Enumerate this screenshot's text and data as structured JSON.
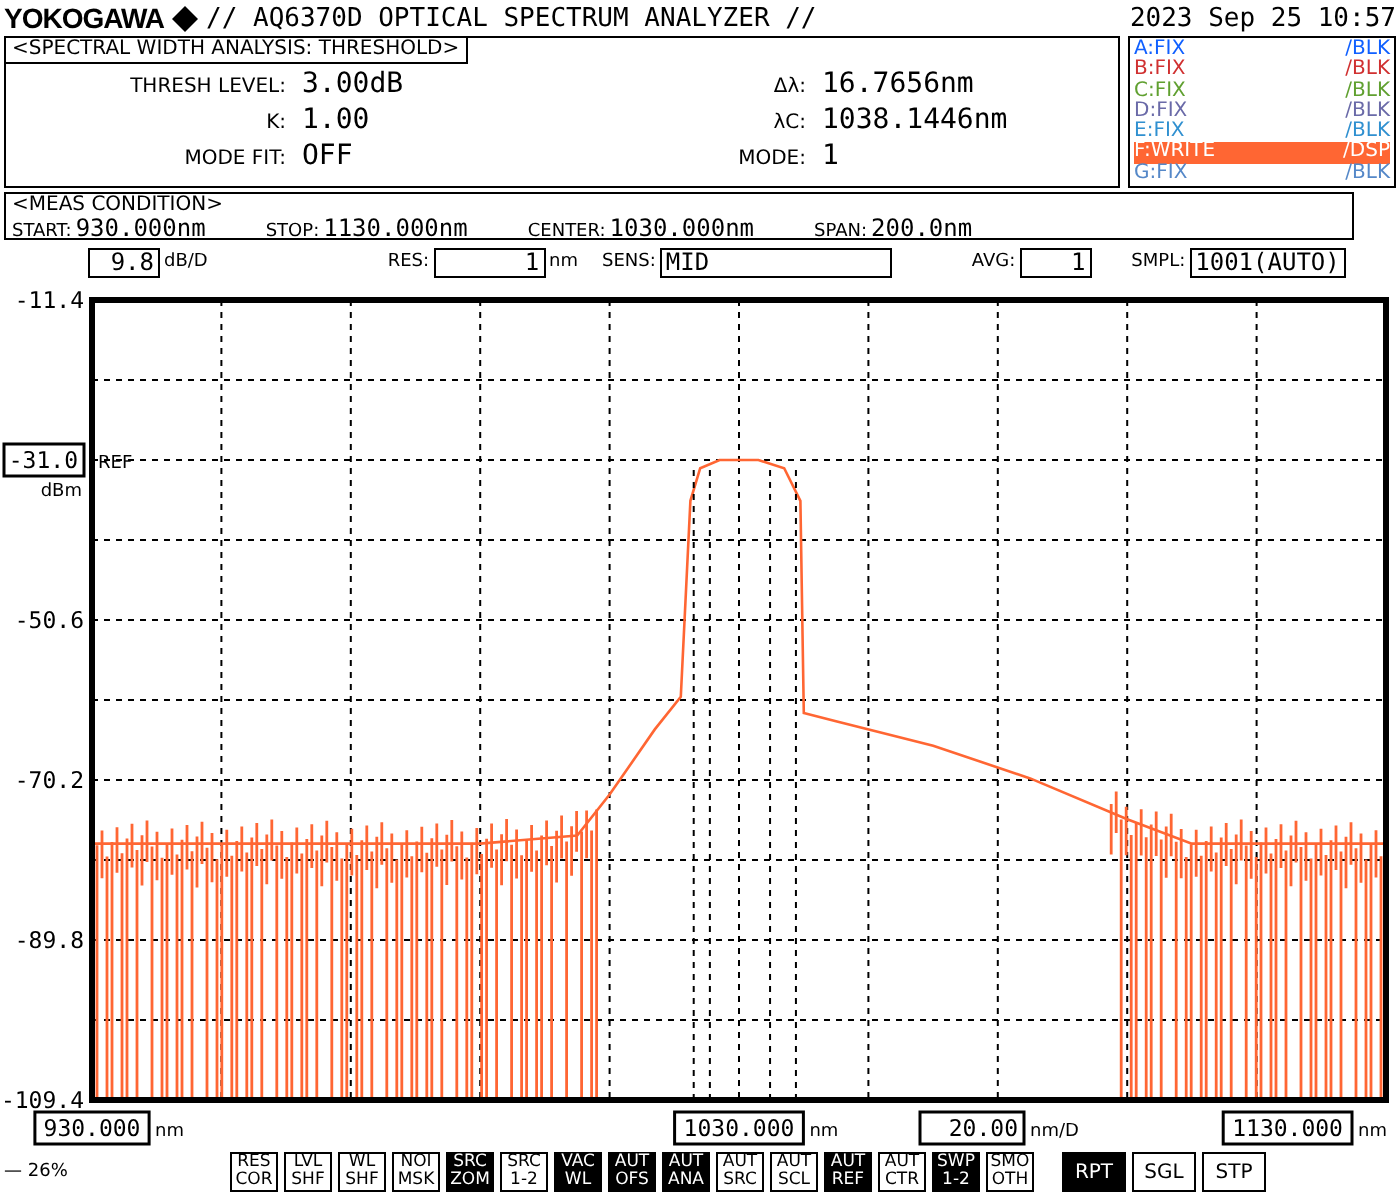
{
  "header": {
    "brand": "YOKOGAWA",
    "title": "// AQ6370D OPTICAL SPECTRUM ANALYZER //",
    "datetime": "2023 Sep 25 10:57"
  },
  "analysis": {
    "title": "<SPECTRAL WIDTH ANALYSIS: THRESHOLD>",
    "left": [
      {
        "label": "THRESH LEVEL:",
        "value": "3.00dB"
      },
      {
        "label": "K:",
        "value": "1.00"
      },
      {
        "label": "MODE FIT:",
        "value": "OFF"
      }
    ],
    "right": [
      {
        "label": "Δλ:",
        "value": "16.7656nm"
      },
      {
        "label": "λC:",
        "value": "1038.1446nm"
      },
      {
        "label": "MODE:",
        "value": "1"
      }
    ]
  },
  "traces": [
    {
      "name": "A:FIX",
      "mode": "/BLK",
      "color": "#1060ff",
      "selected": false
    },
    {
      "name": "B:FIX",
      "mode": "/BLK",
      "color": "#d03030",
      "selected": false
    },
    {
      "name": "C:FIX",
      "mode": "/BLK",
      "color": "#60a030",
      "selected": false
    },
    {
      "name": "D:FIX",
      "mode": "/BLK",
      "color": "#6a6aa8",
      "selected": false
    },
    {
      "name": "E:FIX",
      "mode": "/BLK",
      "color": "#3090d0",
      "selected": false
    },
    {
      "name": "F:WRITE",
      "mode": "/DSP",
      "color": "#ff6633",
      "selected": true
    },
    {
      "name": "G:FIX",
      "mode": "/BLK",
      "color": "#5588c8",
      "selected": false
    }
  ],
  "meas_condition": {
    "title": "<MEAS CONDITION>",
    "items": [
      {
        "label": "START:",
        "value": "930.000nm"
      },
      {
        "label": "STOP:",
        "value": "1130.000nm"
      },
      {
        "label": "CENTER:",
        "value": "1030.000nm"
      },
      {
        "label": "SPAN:",
        "value": "200.0nm"
      }
    ]
  },
  "settings": [
    {
      "value": "9.8",
      "unit": "dB/D"
    },
    {
      "label": "RES:",
      "value": "1",
      "unit": "nm"
    },
    {
      "label": "SENS:",
      "value": "MID"
    },
    {
      "label": "AVG:",
      "value": "1"
    },
    {
      "label": "SMPL:",
      "value": "1001(AUTO)"
    }
  ],
  "ref_level": {
    "value": "-31.0",
    "unit": "dBm",
    "marker": "REF"
  },
  "chart_data": {
    "type": "line",
    "grid": true,
    "ref_lines": [
      {
        "axis": "x",
        "value": 1023
      },
      {
        "axis": "x",
        "value": 1025.5
      },
      {
        "axis": "x",
        "value": 1034.8
      },
      {
        "axis": "x",
        "value": 1038.8
      }
    ],
    "xlim": [
      930,
      1130
    ],
    "ylim": [
      -109.4,
      -11.4
    ],
    "xlabel": "nm",
    "yticks": [
      {
        "value": -11.4,
        "label": "-11.4"
      },
      {
        "value": -50.6,
        "label": "-50.6"
      },
      {
        "value": -70.2,
        "label": "-70.2"
      },
      {
        "value": -89.8,
        "label": "-89.8"
      },
      {
        "value": -109.4,
        "label": "-109.4"
      }
    ],
    "xticks": [
      {
        "value": 930,
        "label": "930.000"
      },
      {
        "value": 1030,
        "label": "1030.000"
      }
    ],
    "x": [
      930,
      960,
      990,
      1005,
      1010,
      1017,
      1021,
      1022.5,
      1024,
      1027,
      1033,
      1037,
      1039.5,
      1040,
      1045,
      1060,
      1075,
      1090,
      1100,
      1130
    ],
    "series": [
      {
        "color": "#ff6633",
        "values": [
          -78,
          -78,
          -78,
          -77,
          -72,
          -64,
          -60,
          -36,
          -32,
          -31,
          -31,
          -32,
          -36,
          -62,
          -63,
          -66,
          -70,
          -75,
          -78,
          -78
        ]
      }
    ]
  },
  "x_scale": {
    "value": "20.00",
    "unit": "nm/D"
  },
  "x_stop": {
    "value": "1130.000",
    "unit": "nm"
  },
  "status": "— 26%",
  "soft_keys": [
    {
      "lines": [
        "RES",
        "COR"
      ],
      "on": false
    },
    {
      "lines": [
        "LVL",
        "SHF"
      ],
      "on": false
    },
    {
      "lines": [
        "WL",
        "SHF"
      ],
      "on": false
    },
    {
      "lines": [
        "NOI",
        "MSK"
      ],
      "on": false
    },
    {
      "lines": [
        "SRC",
        "ZOM"
      ],
      "on": true
    },
    {
      "lines": [
        "SRC",
        "1-2"
      ],
      "on": false
    },
    {
      "lines": [
        "VAC",
        "WL"
      ],
      "on": true
    },
    {
      "lines": [
        "AUT",
        "OFS"
      ],
      "on": true
    },
    {
      "lines": [
        "AUT",
        "ANA"
      ],
      "on": true
    },
    {
      "lines": [
        "AUT",
        "SRC"
      ],
      "on": false
    },
    {
      "lines": [
        "AUT",
        "SCL"
      ],
      "on": false
    },
    {
      "lines": [
        "AUT",
        "REF"
      ],
      "on": true
    },
    {
      "lines": [
        "AUT",
        "CTR"
      ],
      "on": false
    },
    {
      "lines": [
        "SWP",
        "1-2"
      ],
      "on": true
    },
    {
      "lines": [
        "SMO",
        "OTH"
      ],
      "on": false
    }
  ],
  "sweep_keys": [
    {
      "label": "RPT",
      "selected": true
    },
    {
      "label": "SGL",
      "selected": false
    },
    {
      "label": "STP",
      "selected": false
    }
  ]
}
